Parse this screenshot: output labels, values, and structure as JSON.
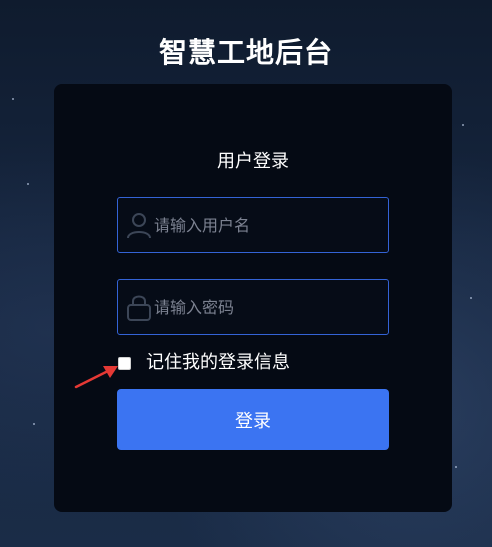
{
  "app": {
    "title": "智慧工地后台"
  },
  "login": {
    "heading": "用户登录",
    "username": {
      "placeholder": "请输入用户名",
      "value": "",
      "icon": "user-icon"
    },
    "password": {
      "placeholder": "请输入密码",
      "value": "",
      "icon": "lock-icon"
    },
    "remember": {
      "label": "记住我的登录信息",
      "checked": false
    },
    "submit_label": "登录"
  },
  "colors": {
    "accent": "#3b74f2",
    "field_border": "#3463d6",
    "card_background": "#050a14",
    "annotation": "#e53935"
  }
}
